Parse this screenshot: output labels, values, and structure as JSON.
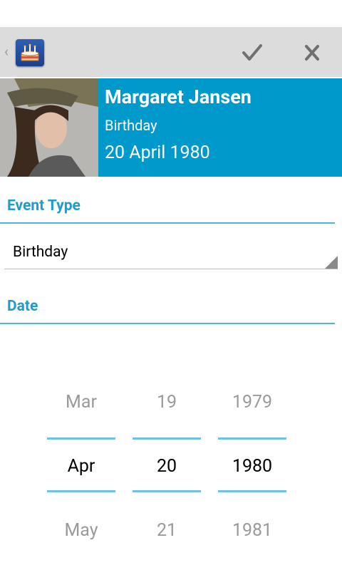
{
  "header": {
    "name": "Margaret Jansen",
    "event_type": "Birthday",
    "date_text": "20 April 1980"
  },
  "actionbar": {
    "app_icon": "birthday-cake-icon",
    "confirm_icon": "check-icon",
    "close_icon": "close-x-icon"
  },
  "event_type_section": {
    "title": "Event Type",
    "selected": "Birthday"
  },
  "date_section": {
    "title": "Date"
  },
  "picker": {
    "month": {
      "prev": "Mar",
      "current": "Apr",
      "next": "May"
    },
    "day": {
      "prev": "19",
      "current": "20",
      "next": "21"
    },
    "year": {
      "prev": "1979",
      "current": "1980",
      "next": "1981"
    }
  },
  "colors": {
    "accent": "#0099cc",
    "section_title": "#1e9ccf",
    "picker_line": "#6ec1e6",
    "actionbar": "#dcdcdc"
  }
}
